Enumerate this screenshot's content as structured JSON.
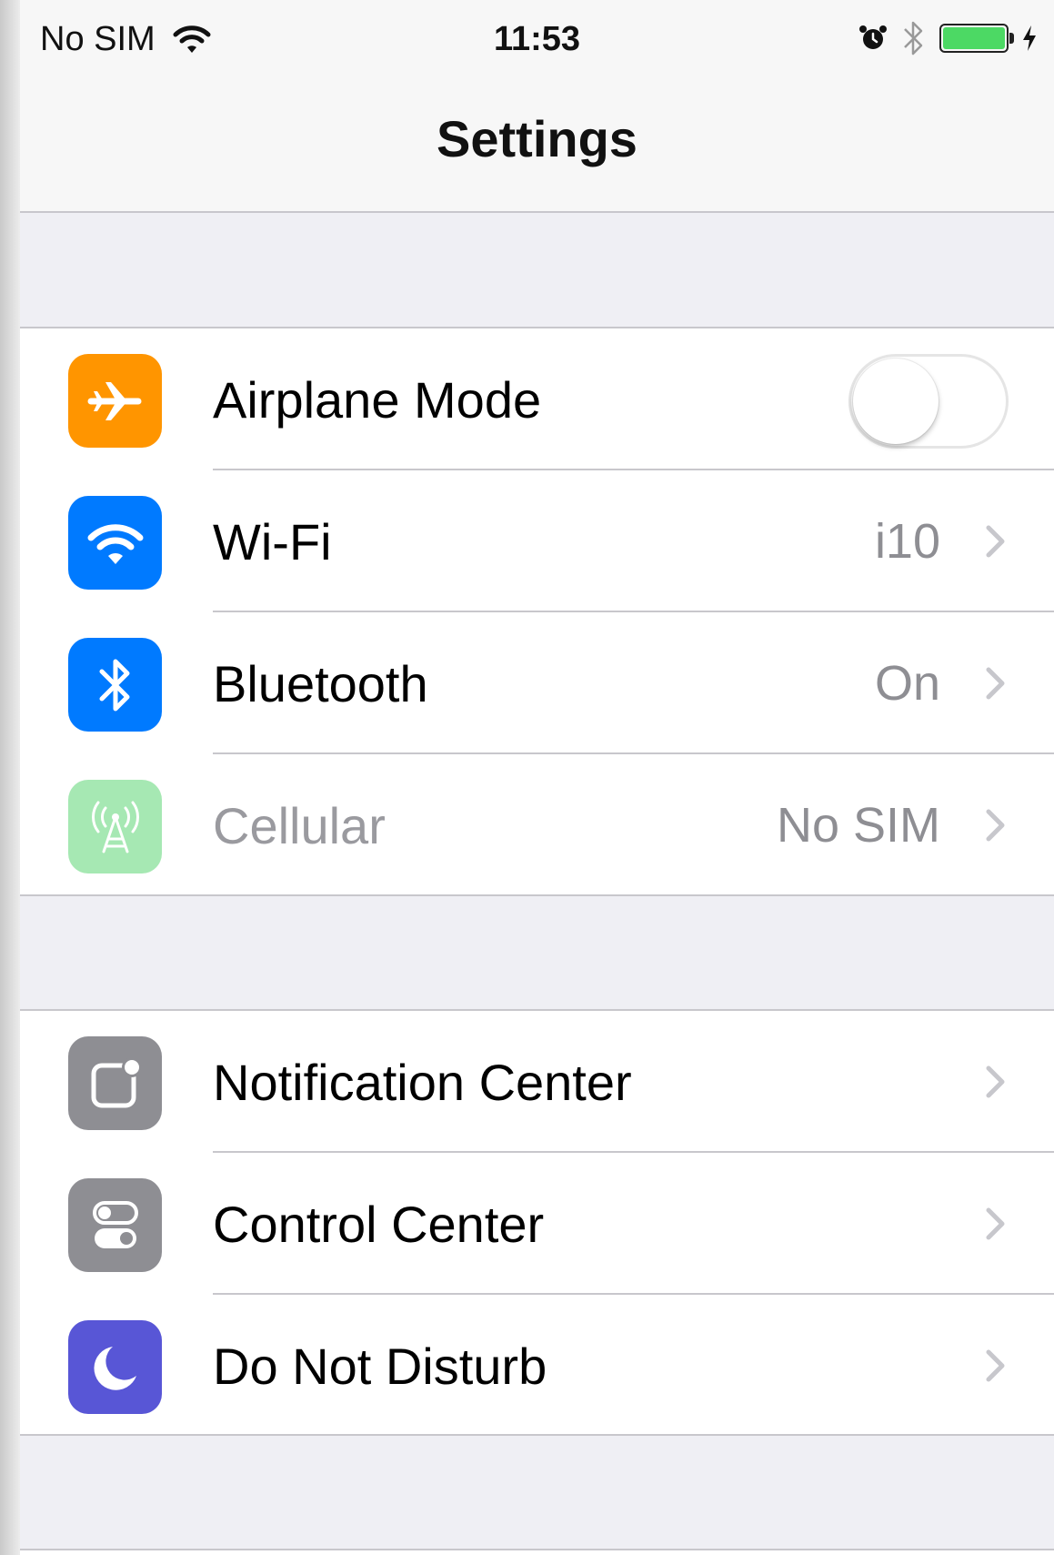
{
  "status_bar": {
    "carrier": "No SIM",
    "time": "11:53",
    "battery_level_percent": 100,
    "icons": [
      "wifi-icon",
      "alarm-icon",
      "bluetooth-icon",
      "battery-icon",
      "charging-icon"
    ]
  },
  "nav": {
    "title": "Settings"
  },
  "groups": [
    {
      "rows": [
        {
          "label": "Airplane Mode",
          "icon": "airplane-icon",
          "icon_color": "#ff9500",
          "control": "toggle",
          "toggle_on": false
        },
        {
          "label": "Wi-Fi",
          "icon": "wifi-icon",
          "icon_color": "#007aff",
          "value": "i10",
          "control": "chevron"
        },
        {
          "label": "Bluetooth",
          "icon": "bluetooth-icon",
          "icon_color": "#007aff",
          "value": "On",
          "control": "chevron"
        },
        {
          "label": "Cellular",
          "icon": "cellular-icon",
          "icon_color": "#a6e8b3",
          "value": "No SIM",
          "control": "chevron",
          "disabled": true
        }
      ]
    },
    {
      "rows": [
        {
          "label": "Notification Center",
          "icon": "notification-center-icon",
          "icon_color": "#8e8e93",
          "control": "chevron"
        },
        {
          "label": "Control Center",
          "icon": "control-center-icon",
          "icon_color": "#8e8e93",
          "control": "chevron"
        },
        {
          "label": "Do Not Disturb",
          "icon": "moon-icon",
          "icon_color": "#5856d6",
          "control": "chevron"
        }
      ]
    }
  ],
  "colors": {
    "background": "#efeff4",
    "separator": "#c8c7cc",
    "value_text": "#8e8e93",
    "battery_fill": "#4cd964"
  }
}
